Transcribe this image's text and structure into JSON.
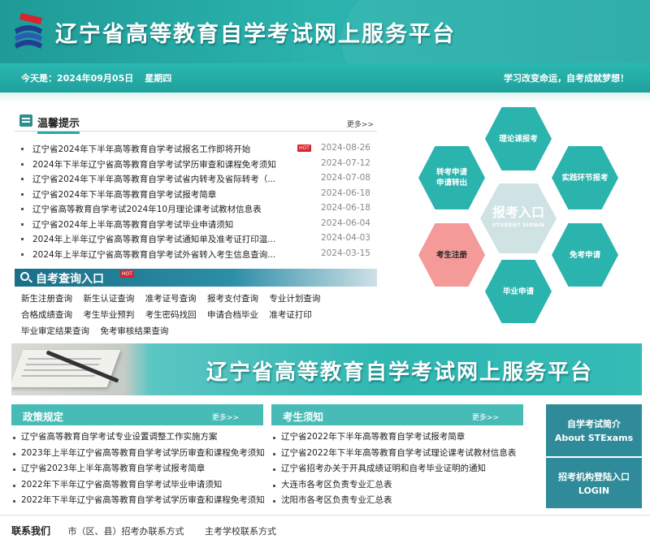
{
  "header": {
    "site_title": "辽宁省高等教育自学考试网上服务平台",
    "date_prefix": "今天是：",
    "date": "2024年09月05日",
    "weekday": "星期四",
    "slogan": "学习改变命运，自考成就梦想！"
  },
  "notices": {
    "title": "温馨提示",
    "more": "更多>>",
    "hot_badge": "HOT",
    "items": [
      {
        "title": "辽宁省2024年下半年高等教育自学考试报名工作即将开始",
        "date": "2024-08-26",
        "hot": true
      },
      {
        "title": "2024年下半年辽宁省高等教育自学考试学历审查和课程免考须知",
        "date": "2024-07-12"
      },
      {
        "title": "辽宁省2024年下半年高等教育自学考试省内转考及省际转考（...",
        "date": "2024-07-08"
      },
      {
        "title": "辽宁省2024年下半年高等教育自学考试报考简章",
        "date": "2024-06-18"
      },
      {
        "title": "辽宁省高等教育自学考试2024年10月理论课考试教材信息表",
        "date": "2024-06-18"
      },
      {
        "title": "辽宁省2024年上半年高等教育自学考试毕业申请须知",
        "date": "2024-06-04"
      },
      {
        "title": "2024年上半年辽宁省高等教育自学考试通知单及准考证打印温...",
        "date": "2024-04-03"
      },
      {
        "title": "2024年上半年辽宁省高等教育自学考试外省转入考生信息查询...",
        "date": "2024-03-15"
      }
    ]
  },
  "query": {
    "title": "自考查询入口",
    "hot_badge": "HOT",
    "links": [
      "新生注册查询",
      "新生认证查询",
      "准考证号查询",
      "报考支付查询",
      "专业计划查询",
      "合格成绩查询",
      "考生毕业预判",
      "考生密码找回",
      "申请合档毕业",
      "准考证打印",
      "毕业审定结果查询",
      "免考审核结果查询"
    ]
  },
  "hex_menu": {
    "theory": "理论课报考",
    "transfer_line1": "转考申请",
    "transfer_line2": "申请转出",
    "practice": "实践环节报考",
    "center_big": "报考入口",
    "center_small": "STUDENT SIGNIN",
    "register": "考生注册",
    "exempt": "免考申请",
    "graduate": "毕业申请"
  },
  "banner": {
    "title": "辽宁省高等教育自学考试网上服务平台"
  },
  "policy": {
    "title": "政策规定",
    "more": "更多>>",
    "items": [
      "辽宁省高等教育自学考试专业设置调整工作实施方案",
      "2023年上半年辽宁省高等教育自学考试学历审查和课程免考须知",
      "辽宁省2023年上半年高等教育自学考试报考简章",
      "2022年下半年辽宁省高等教育自学考试毕业申请须知",
      "2022年下半年辽宁省高等教育自学考试学历审查和课程免考须知"
    ]
  },
  "candidate": {
    "title": "考生须知",
    "more": "更多>>",
    "items": [
      "辽宁省2022年下半年高等教育自学考试报考简章",
      "辽宁省2022年下半年高等教育自学考试理论课考试教材信息表",
      "辽宁省招考办关于开具成绩证明和自考毕业证明的通知",
      "大连市各考区负责专业汇总表",
      "沈阳市各考区负责专业汇总表"
    ]
  },
  "side": {
    "intro_cn": "自学考试简介",
    "intro_en": "About STExams",
    "login_cn": "招考机构登陆入口",
    "login_en": "LOGIN"
  },
  "footer": {
    "label": "联系我们",
    "link1": "市（区、县）招考办联系方式",
    "link2": "主考学校联系方式"
  },
  "colors": {
    "teal": "#2bb3ad",
    "pink": "#f49a99",
    "hot": "#d9232e",
    "side": "#2f8b9a"
  }
}
